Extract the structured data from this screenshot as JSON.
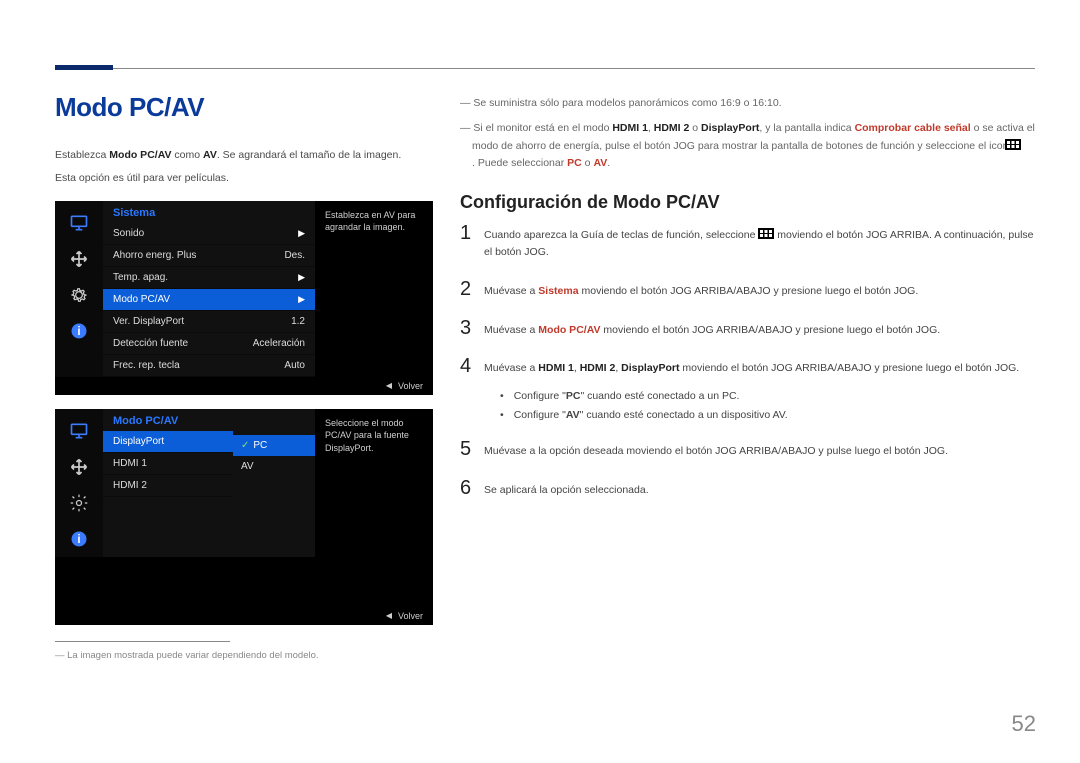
{
  "page_number": "52",
  "title": "Modo PC/AV",
  "intro": {
    "line1_pre": "Establezca ",
    "line1_b1": "Modo PC/AV",
    "line1_mid": " como ",
    "line1_b2": "AV",
    "line1_post": ". Se agrandará el tamaño de la imagen.",
    "line2": "Esta opción es útil para ver películas."
  },
  "osd1": {
    "header": "Sistema",
    "rows": [
      {
        "label": "Sonido",
        "value": "",
        "arrow": true
      },
      {
        "label": "Ahorro energ. Plus",
        "value": "Des."
      },
      {
        "label": "Temp. apag.",
        "value": "",
        "arrow": true
      },
      {
        "label": "Modo PC/AV",
        "value": "",
        "arrow": true,
        "hl": true
      },
      {
        "label": "Ver. DisplayPort",
        "value": "1.2"
      },
      {
        "label": "Detección fuente",
        "value": "Aceleración"
      },
      {
        "label": "Frec. rep. tecla",
        "value": "Auto"
      }
    ],
    "hint": "Establezca en AV para agrandar la imagen.",
    "footer": "Volver"
  },
  "osd2": {
    "header": "Modo PC/AV",
    "rows": [
      {
        "label": "DisplayPort",
        "hl": true
      },
      {
        "label": "HDMI 1"
      },
      {
        "label": "HDMI 2"
      }
    ],
    "sub": [
      {
        "label": "PC",
        "hl": true,
        "check": true
      },
      {
        "label": "AV"
      }
    ],
    "hint": "Seleccione el modo PC/AV para la fuente DisplayPort.",
    "footer": "Volver"
  },
  "footnote": "La imagen mostrada puede variar dependiendo del modelo.",
  "notes": {
    "n1": "Se suministra sólo para modelos panorámicos como 16:9 o 16:10.",
    "n2_a": "Si el monitor está en el modo ",
    "n2_b1": "HDMI 1",
    "n2_c1": ", ",
    "n2_b2": "HDMI 2",
    "n2_c2": " o ",
    "n2_b3": "DisplayPort",
    "n2_d": ", y la pantalla indica ",
    "n2_r": "Comprobar cable señal",
    "n2_e": " o se activa el modo de ahorro de energía, pulse el botón JOG para mostrar la pantalla de botones de función y seleccione el icono ",
    "n2_f": ". Puede seleccionar ",
    "n2_pc": "PC",
    "n2_o": " o ",
    "n2_av": "AV",
    "n2_dot": "."
  },
  "subheading": "Configuración de Modo PC/AV",
  "steps": {
    "s1a": "Cuando aparezca la Guía de teclas de función, seleccione ",
    "s1b": " moviendo el botón JOG ARRIBA. A continuación, pulse el botón JOG.",
    "s2a": "Muévase a ",
    "s2r": "Sistema",
    "s2b": " moviendo el botón JOG ARRIBA/ABAJO y presione luego el botón JOG.",
    "s3a": "Muévase a ",
    "s3r": "Modo PC/AV",
    "s3b": " moviendo el botón JOG ARRIBA/ABAJO y presione luego el botón JOG.",
    "s4a": "Muévase a ",
    "s4b1": "HDMI 1",
    "s4c1": ", ",
    "s4b2": "HDMI 2",
    "s4c2": ", ",
    "s4b3": "DisplayPort",
    "s4d": " moviendo el botón JOG ARRIBA/ABAJO y presione luego el botón JOG.",
    "b1a": "Configure \"",
    "b1r": "PC",
    "b1b": "\" cuando esté conectado a un PC.",
    "b2a": "Configure \"",
    "b2r": "AV",
    "b2b": "\" cuando esté conectado a un dispositivo AV.",
    "s5": "Muévase a la opción deseada moviendo el botón JOG ARRIBA/ABAJO y pulse luego el botón JOG.",
    "s6": "Se aplicará la opción seleccionada."
  }
}
